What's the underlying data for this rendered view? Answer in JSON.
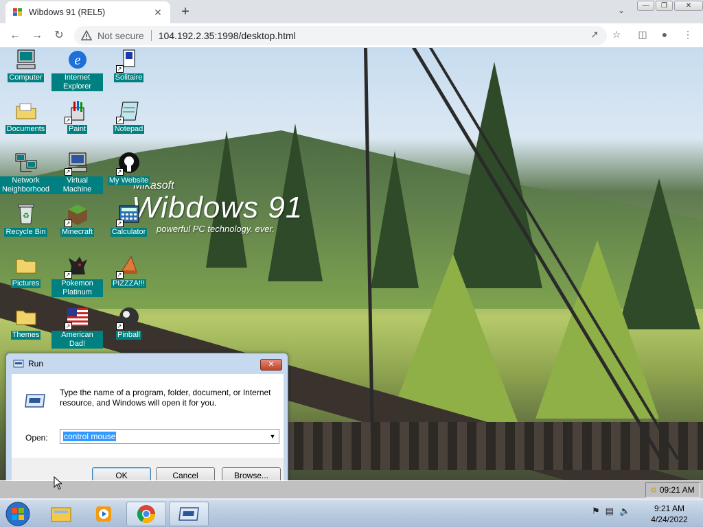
{
  "browser": {
    "tab_title": "Wibdows 91 (REL5)",
    "tab_close": "✕",
    "new_tab": "+",
    "security_label": "Not secure",
    "url": "104.192.2.35:1998/desktop.html"
  },
  "desktop": {
    "brand": "Mikasoft",
    "os_name": "Wibdows 91",
    "tagline": "powerful PC technology. ever.",
    "icons": [
      {
        "label": "Computer",
        "icon": "computer-icon"
      },
      {
        "label": "Internet Explorer",
        "icon": "internet-explorer-icon"
      },
      {
        "label": "Solitaire",
        "icon": "solitaire-icon"
      },
      {
        "label": "Documents",
        "icon": "documents-folder-icon"
      },
      {
        "label": "Paint",
        "icon": "paint-icon"
      },
      {
        "label": "Notepad",
        "icon": "notepad-icon"
      },
      {
        "label": "Network Neighborhood",
        "icon": "network-icon"
      },
      {
        "label": "Virtual Machine",
        "icon": "virtual-machine-icon"
      },
      {
        "label": "My Website",
        "icon": "github-icon"
      },
      {
        "label": "Recycle Bin",
        "icon": "recycle-bin-icon"
      },
      {
        "label": "Minecraft",
        "icon": "minecraft-icon"
      },
      {
        "label": "Calculator",
        "icon": "calculator-icon"
      },
      {
        "label": "Pictures",
        "icon": "pictures-folder-icon"
      },
      {
        "label": "Pokemon Platinum",
        "icon": "pokemon-icon"
      },
      {
        "label": "PIZZZA!!!",
        "icon": "pizza-icon"
      },
      {
        "label": "Themes",
        "icon": "themes-folder-icon"
      },
      {
        "label": "American Dad!",
        "icon": "american-flag-icon"
      },
      {
        "label": "Pinball",
        "icon": "pinball-icon"
      }
    ]
  },
  "run_dialog": {
    "title": "Run",
    "close": "✕",
    "description": "Type the name of a program, folder, document, or Internet resource, and Windows will open it for you.",
    "open_label": "Open:",
    "open_value": "control mouse",
    "ok": "OK",
    "cancel": "Cancel",
    "browse": "Browse..."
  },
  "w91_taskbar": {
    "clock": "09:21 AM"
  },
  "win7_taskbar": {
    "time": "9:21 AM",
    "date": "4/24/2022"
  },
  "colors": {
    "icon_label_bg": "#008080",
    "selection": "#3399ff"
  }
}
